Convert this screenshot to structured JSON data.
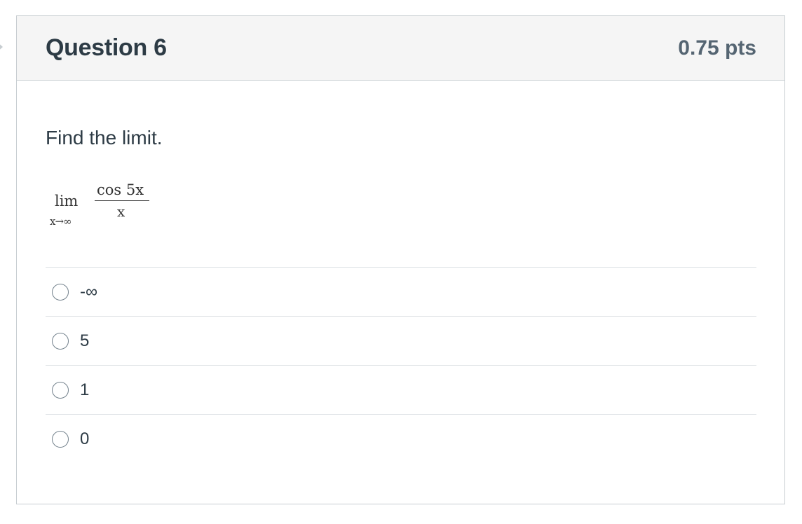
{
  "question": {
    "title": "Question 6",
    "points": "0.75 pts",
    "prompt": "Find the limit.",
    "math": {
      "operator": "lim",
      "subscript": "x→∞",
      "numerator": "cos 5x",
      "denominator": "x"
    },
    "answers": [
      {
        "label": "-∞",
        "selected": false
      },
      {
        "label": "5",
        "selected": false
      },
      {
        "label": "1",
        "selected": false
      },
      {
        "label": "0",
        "selected": false
      }
    ]
  }
}
